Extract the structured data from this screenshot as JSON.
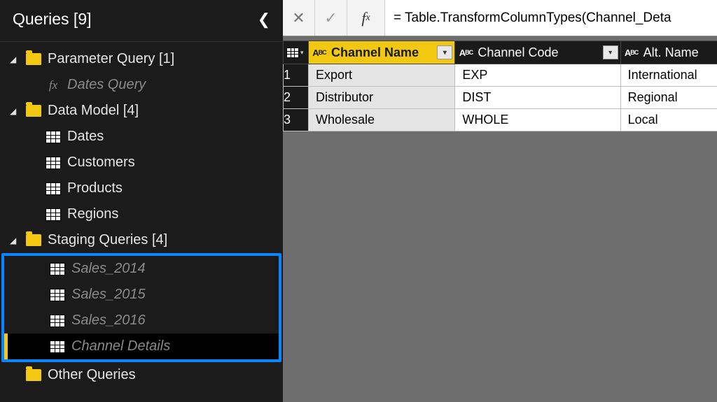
{
  "sidebar": {
    "title": "Queries [9]",
    "groups": [
      {
        "label": "Parameter Query [1]",
        "items": [
          {
            "label": "Dates Query",
            "style": "fx"
          }
        ]
      },
      {
        "label": "Data Model [4]",
        "items": [
          {
            "label": "Dates",
            "style": "table"
          },
          {
            "label": "Customers",
            "style": "table"
          },
          {
            "label": "Products",
            "style": "table"
          },
          {
            "label": "Regions",
            "style": "table"
          }
        ]
      },
      {
        "label": "Staging Queries [4]",
        "items": [
          {
            "label": "Sales_2014",
            "style": "table-dim"
          },
          {
            "label": "Sales_2015",
            "style": "table-dim"
          },
          {
            "label": "Sales_2016",
            "style": "table-dim"
          },
          {
            "label": "Channel Details",
            "style": "table-dim",
            "selected": true
          }
        ],
        "highlighted": true
      },
      {
        "label": "Other Queries",
        "items": []
      }
    ]
  },
  "formula_bar": {
    "value": "= Table.TransformColumnTypes(Channel_Deta"
  },
  "table": {
    "columns": [
      {
        "name": "Channel Name",
        "type": "ABC"
      },
      {
        "name": "Channel Code",
        "type": "ABC"
      },
      {
        "name": "Alt. Name",
        "type": "ABC"
      }
    ],
    "rows": [
      {
        "n": "1",
        "cells": [
          "Export",
          "EXP",
          "International"
        ]
      },
      {
        "n": "2",
        "cells": [
          "Distributor",
          "DIST",
          "Regional"
        ]
      },
      {
        "n": "3",
        "cells": [
          "Wholesale",
          "WHOLE",
          "Local"
        ]
      }
    ]
  }
}
